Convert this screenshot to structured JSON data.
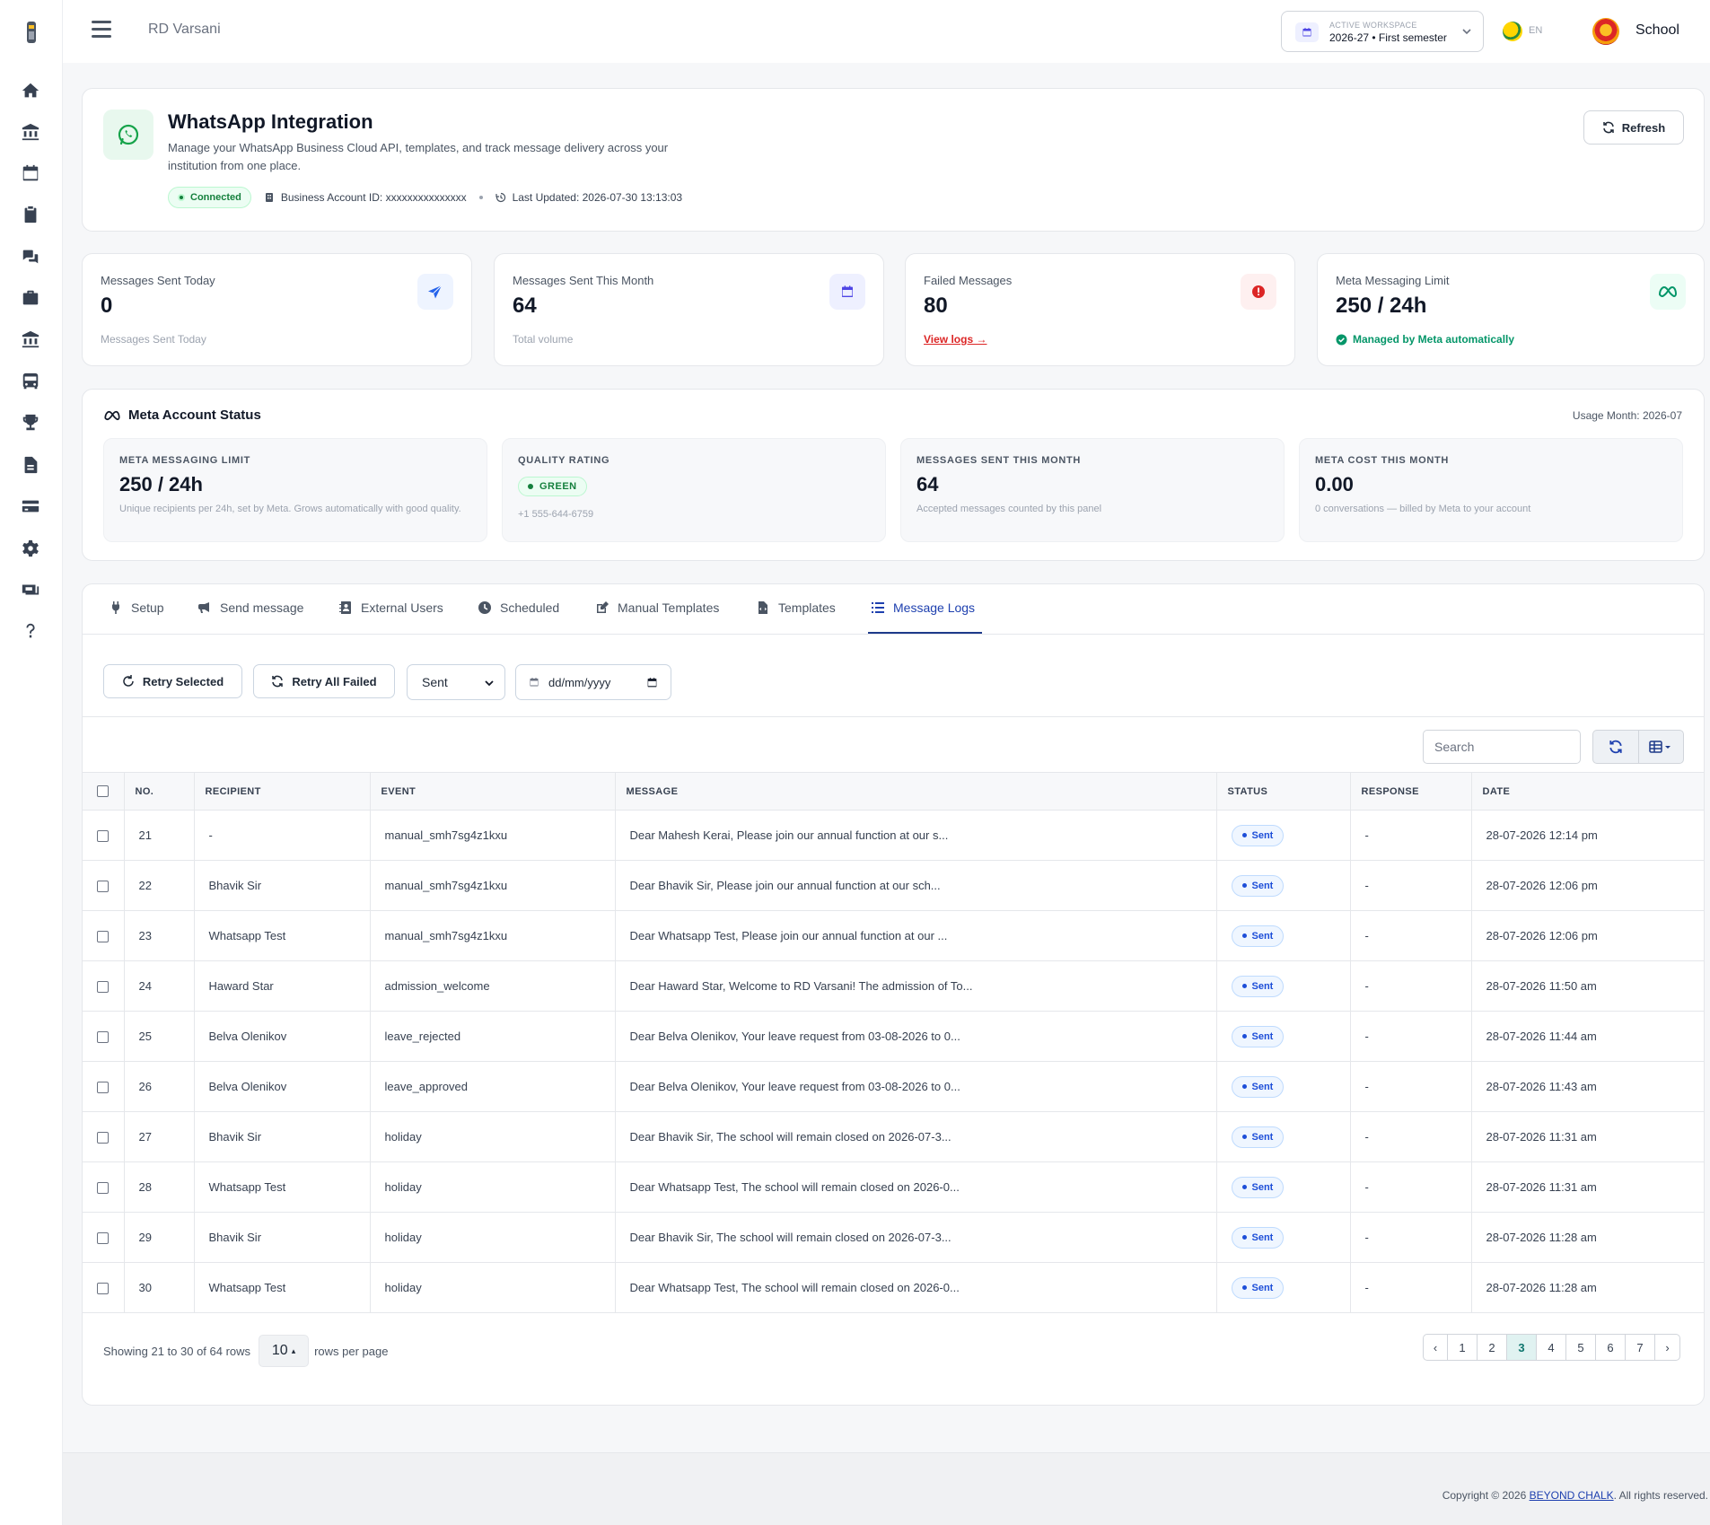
{
  "app": {
    "school_name": "RD Varsani",
    "user_name": "School",
    "language": "EN"
  },
  "workspace": {
    "label": "ACTIVE WORKSPACE",
    "value": "2026-27 • First semester"
  },
  "hero": {
    "title": "WhatsApp Integration",
    "description": "Manage your WhatsApp Business Cloud API, templates, and track message delivery across your institution from one place.",
    "status": "Connected",
    "business_account": "Business Account ID: xxxxxxxxxxxxxxx",
    "last_updated": "Last Updated: 2026-07-30 13:13:03",
    "refresh_label": "Refresh"
  },
  "stats": [
    {
      "label": "Messages Sent Today",
      "value": "0",
      "sub": "Messages Sent Today",
      "icon": "send-icon",
      "color": "#2563eb"
    },
    {
      "label": "Messages Sent This Month",
      "value": "64",
      "sub": "Total volume",
      "icon": "calendar-icon",
      "color": "#4f46e5"
    },
    {
      "label": "Failed Messages",
      "value": "80",
      "sub": "View logs →",
      "icon": "alert-icon",
      "color": "#dc2626"
    },
    {
      "label": "Meta Messaging Limit",
      "value": "250 / 24h",
      "sub": "Managed by Meta automatically",
      "icon": "meta-icon",
      "color": "#059669"
    }
  ],
  "meta_status": {
    "title": "Meta Account Status",
    "usage_month": "Usage Month: 2026-07",
    "boxes": [
      {
        "label": "META MESSAGING LIMIT",
        "value": "250 / 24h",
        "sub": "Unique recipients per 24h, set by Meta. Grows automatically with good quality."
      },
      {
        "label": "QUALITY RATING",
        "value": "GREEN",
        "sub": "+1 555-644-6759"
      },
      {
        "label": "MESSAGES SENT THIS MONTH",
        "value": "64",
        "sub": "Accepted messages counted by this panel"
      },
      {
        "label": "META COST THIS MONTH",
        "value": "0.00",
        "sub": "0 conversations — billed by Meta to your account"
      }
    ]
  },
  "tabs": [
    "Setup",
    "Send message",
    "External Users",
    "Scheduled",
    "Manual Templates",
    "Templates",
    "Message Logs"
  ],
  "active_tab": "Message Logs",
  "toolbar": {
    "retry_selected": "Retry Selected",
    "retry_all": "Retry All Failed",
    "status_filter": "Sent",
    "date_placeholder": "dd/mm/yyyy",
    "search_placeholder": "Search"
  },
  "table": {
    "columns": [
      "NO.",
      "RECIPIENT",
      "EVENT",
      "MESSAGE",
      "STATUS",
      "RESPONSE",
      "DATE"
    ],
    "rows": [
      {
        "no": "21",
        "recipient": "-",
        "event": "manual_smh7sg4z1kxu",
        "message": "Dear Mahesh Kerai, Please join our annual function at our s...",
        "status": "Sent",
        "response": "-",
        "date": "28-07-2026 12:14 pm"
      },
      {
        "no": "22",
        "recipient": "Bhavik Sir",
        "event": "manual_smh7sg4z1kxu",
        "message": "Dear Bhavik Sir, Please join our annual function at our sch...",
        "status": "Sent",
        "response": "-",
        "date": "28-07-2026 12:06 pm"
      },
      {
        "no": "23",
        "recipient": "Whatsapp Test",
        "event": "manual_smh7sg4z1kxu",
        "message": "Dear Whatsapp Test, Please join our annual function at our ...",
        "status": "Sent",
        "response": "-",
        "date": "28-07-2026 12:06 pm"
      },
      {
        "no": "24",
        "recipient": "Haward Star",
        "event": "admission_welcome",
        "message": "Dear Haward Star, Welcome to RD Varsani! The admission of To...",
        "status": "Sent",
        "response": "-",
        "date": "28-07-2026 11:50 am"
      },
      {
        "no": "25",
        "recipient": "Belva Olenikov",
        "event": "leave_rejected",
        "message": "Dear Belva Olenikov, Your leave request from 03-08-2026 to 0...",
        "status": "Sent",
        "response": "-",
        "date": "28-07-2026 11:44 am"
      },
      {
        "no": "26",
        "recipient": "Belva Olenikov",
        "event": "leave_approved",
        "message": "Dear Belva Olenikov, Your leave request from 03-08-2026 to 0...",
        "status": "Sent",
        "response": "-",
        "date": "28-07-2026 11:43 am"
      },
      {
        "no": "27",
        "recipient": "Bhavik Sir",
        "event": "holiday",
        "message": "Dear Bhavik Sir, The school will remain closed on 2026-07-3...",
        "status": "Sent",
        "response": "-",
        "date": "28-07-2026 11:31 am"
      },
      {
        "no": "28",
        "recipient": "Whatsapp Test",
        "event": "holiday",
        "message": "Dear Whatsapp Test, The school will remain closed on 2026-0...",
        "status": "Sent",
        "response": "-",
        "date": "28-07-2026 11:31 am"
      },
      {
        "no": "29",
        "recipient": "Bhavik Sir",
        "event": "holiday",
        "message": "Dear Bhavik Sir, The school will remain closed on 2026-07-3...",
        "status": "Sent",
        "response": "-",
        "date": "28-07-2026 11:28 am"
      },
      {
        "no": "30",
        "recipient": "Whatsapp Test",
        "event": "holiday",
        "message": "Dear Whatsapp Test, The school will remain closed on 2026-0...",
        "status": "Sent",
        "response": "-",
        "date": "28-07-2026 11:28 am"
      }
    ]
  },
  "pagination": {
    "showing": "Showing 21 to 30 of 64 rows",
    "rows_per_page": "10",
    "rows_per_page_label": "rows per page",
    "pages": [
      "‹",
      "1",
      "2",
      "3",
      "4",
      "5",
      "6",
      "7",
      "›"
    ],
    "current": "3"
  },
  "footer": {
    "copyright_prefix": "Copyright © 2026",
    "brand": "BEYOND CHALK",
    "suffix": ". All rights reserved."
  },
  "sidebar": {
    "icons": [
      "home-icon",
      "bank-icon",
      "calendar-icon",
      "clipboard-icon",
      "chat-icon",
      "briefcase-icon",
      "institution-icon",
      "bus-icon",
      "trophy-icon",
      "document-icon",
      "card-icon",
      "gear-icon",
      "money-icon",
      "help-icon"
    ]
  }
}
